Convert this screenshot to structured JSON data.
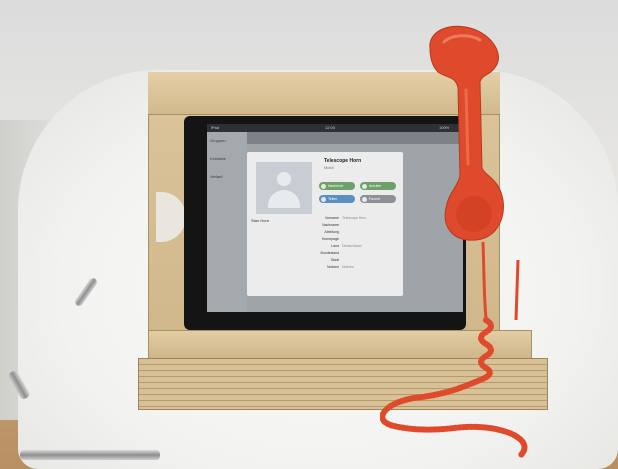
{
  "tablet_screen": {
    "status_bar": {
      "left": "iPad",
      "center": "12:00",
      "right": "100%"
    },
    "sidebar": [
      {
        "label": "Gruppen"
      },
      {
        "label": "Kontakte"
      },
      {
        "label": "Verlauf"
      }
    ],
    "card": {
      "contact_name": "Telescope Horn",
      "contact_sub": "Mobil",
      "name_left": "Stan Horn",
      "actions": [
        {
          "label": "Nachricht",
          "color": "#6f9f6a"
        },
        {
          "label": "Anrufen",
          "color": "#6f9f6a"
        },
        {
          "label": "Teilen",
          "color": "#5a8fc2"
        },
        {
          "label": "Favorit",
          "color": "#8d9196"
        }
      ],
      "fields": [
        {
          "key": "Vorname",
          "value": "Telescope Horn"
        },
        {
          "key": "Nachname",
          "value": ""
        },
        {
          "key": "Abteilung",
          "value": ""
        },
        {
          "key": "Homepage",
          "value": ""
        },
        {
          "key": "Land",
          "value": "Deutschland"
        },
        {
          "key": "Bundesland",
          "value": ""
        },
        {
          "key": "Stadt",
          "value": ""
        },
        {
          "key": "Notizen",
          "value": "Notizen"
        }
      ]
    }
  },
  "colors": {
    "handset": "#e04a2c",
    "wood": "#d8c197",
    "bezel": "#141414"
  }
}
